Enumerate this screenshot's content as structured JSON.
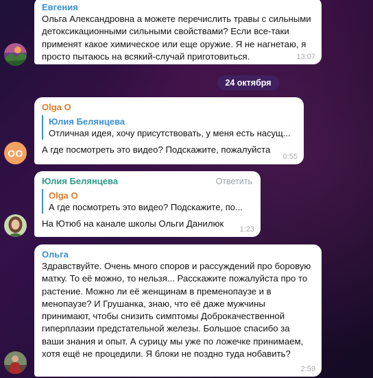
{
  "colors": {
    "name_evgenia": "#3a8fd6",
    "name_olga_o": "#e07b2a",
    "name_yulia": "#2e9b8a",
    "name_olga": "#3a8fd6",
    "avatar_oo": "#f4a261"
  },
  "date_separator": "24 октября",
  "messages": [
    {
      "sender": "Евгения",
      "text": "Ольга Александровна а можете перечислить травы с сильными детоксикационными сильными свойствами? Если все-таки применят какое химическое или еще оружие. Я не нагнетаю, я просто пытаюсь на всякий-случай приготовиться.",
      "time": "13:07",
      "avatar_icon": "landscape-photo-avatar"
    },
    {
      "sender": "Olga O",
      "avatar_initials": "OO",
      "quote": {
        "author": "Юлия Белянцева",
        "text": "Отличная идея, хочу присутствовать, у меня есть насущ..."
      },
      "text": "А где посмотреть это видео? Подскажите, пожалуйста",
      "time": "0:55"
    },
    {
      "sender": "Юлия Белянцева",
      "reply_label": "Ответить",
      "quote": {
        "author": "Olga O",
        "text": "А где посмотреть это видео? Подскажите, по..."
      },
      "text": "На Ютюб на канале школы Ольги Данилюк",
      "time": "1:23",
      "avatar_icon": "woman-portrait-avatar"
    },
    {
      "sender": "Ольга",
      "text": "Здравствуйте. Очень много споров и рассуждений про боровую матку. То её можно, то нельзя... Расскажите пожалуйста про то растение. Можно ли её женщинам в пременопаузе и в менопаузе? И Грушанка, знаю, что её даже мужчины принимают, чтобы снизить симптомы Доброкачественной гиперплазии предстательной железы. Большое спасибо за ваши знания и опыт. А сурицу мы уже по ложечке принимаем, хотя ещё не процедили. Я блоки не поздно туда нобавить?",
      "time": "2:59",
      "avatar_icon": "person-outdoor-avatar"
    }
  ]
}
